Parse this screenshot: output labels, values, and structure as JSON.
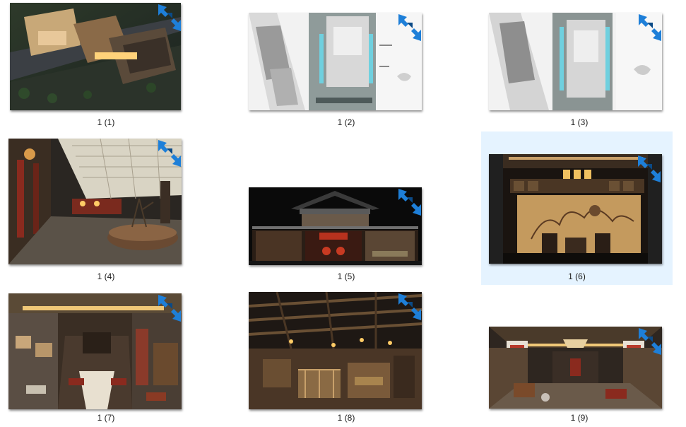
{
  "items": [
    {
      "label": "1 (1)",
      "kind": "aerial"
    },
    {
      "label": "1 (2)",
      "kind": "plan"
    },
    {
      "label": "1 (3)",
      "kind": "plan"
    },
    {
      "label": "1 (4)",
      "kind": "lobby"
    },
    {
      "label": "1 (5)",
      "kind": "section"
    },
    {
      "label": "1 (6)",
      "kind": "elevation"
    },
    {
      "label": "1 (7)",
      "kind": "dining"
    },
    {
      "label": "1 (8)",
      "kind": "hall"
    },
    {
      "label": "1 (9)",
      "kind": "corridor"
    }
  ],
  "selected_index": 5,
  "colors": {
    "selection_bg": "#e5f3ff",
    "overlay_arrow": "#1e7fd8"
  },
  "overlay_icon": "compressed-arrows-icon"
}
